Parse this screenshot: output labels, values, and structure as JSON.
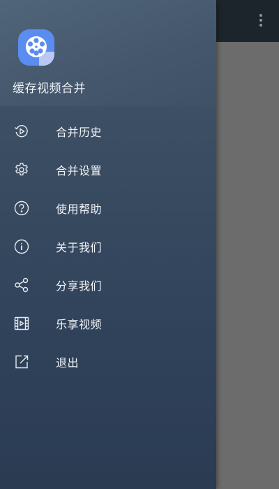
{
  "drawer": {
    "app_name": "缓存视频合并",
    "items": [
      {
        "label": "合并历史",
        "icon": "history-icon"
      },
      {
        "label": "合并设置",
        "icon": "gear-icon"
      },
      {
        "label": "使用帮助",
        "icon": "help-icon"
      },
      {
        "label": "关于我们",
        "icon": "info-icon"
      },
      {
        "label": "分享我们",
        "icon": "share-icon"
      },
      {
        "label": "乐享视频",
        "icon": "film-icon"
      },
      {
        "label": "退出",
        "icon": "exit-icon"
      }
    ]
  },
  "colors": {
    "drawer_top": "#44566b",
    "drawer_bottom": "#2a3b52",
    "app_bar": "#1d252c",
    "scrim": "#6c6c6c",
    "logo_blue": "#5b8df0"
  }
}
